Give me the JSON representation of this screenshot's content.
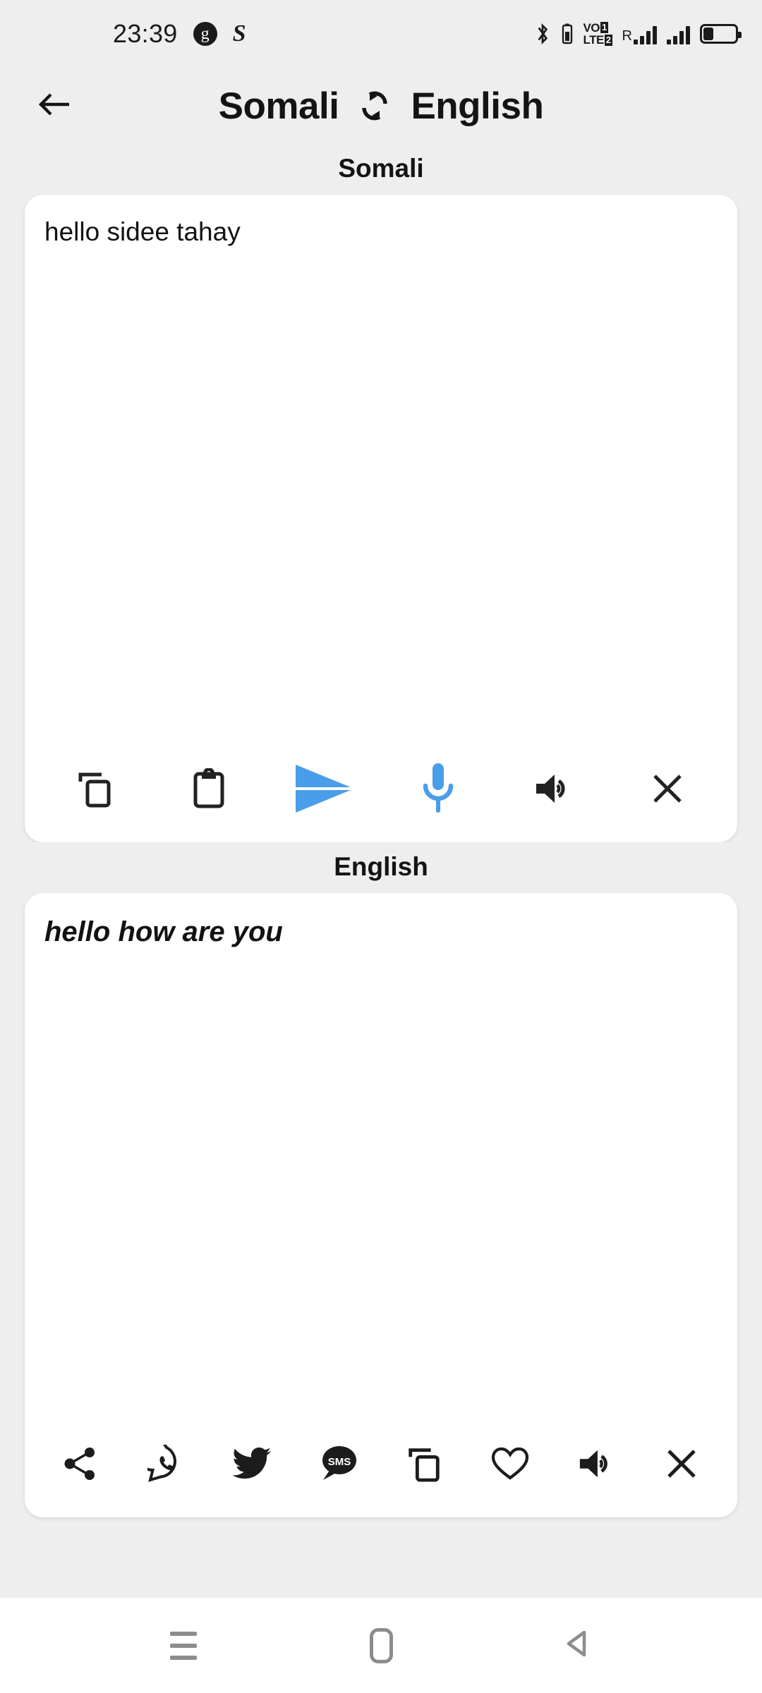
{
  "status_bar": {
    "clock": "23:39",
    "app_icon_g": "g",
    "app_icon_s": "S",
    "bluetooth_icon": "bluetooth-icon",
    "volte_line1": "VO",
    "volte_line2": "LTE",
    "sim1_label": "1",
    "sim2_label": "2",
    "roaming_label": "R",
    "battery_icon": "battery-low-icon"
  },
  "header": {
    "back_icon": "back-arrow-icon",
    "source_language": "Somali",
    "swap_icon": "swap-languages-icon",
    "target_language": "English"
  },
  "source_section": {
    "label": "Somali",
    "text": "hello sidee tahay",
    "toolbar": [
      {
        "name": "copy-icon",
        "label": "Copy",
        "accent": "#222222"
      },
      {
        "name": "paste-icon",
        "label": "Paste",
        "accent": "#222222"
      },
      {
        "name": "send-icon",
        "label": "Translate",
        "accent": "#4A9DE8"
      },
      {
        "name": "microphone-icon",
        "label": "Voice input",
        "accent": "#4A9DE8"
      },
      {
        "name": "speaker-icon",
        "label": "Speak",
        "accent": "#222222"
      },
      {
        "name": "clear-icon",
        "label": "Clear",
        "accent": "#222222"
      }
    ]
  },
  "target_section": {
    "label": "English",
    "text": "hello how are you",
    "toolbar": [
      {
        "name": "share-icon",
        "label": "Share"
      },
      {
        "name": "whatsapp-icon",
        "label": "WhatsApp"
      },
      {
        "name": "twitter-icon",
        "label": "Twitter"
      },
      {
        "name": "sms-icon",
        "label": "SMS"
      },
      {
        "name": "copy-icon",
        "label": "Copy"
      },
      {
        "name": "favorite-icon",
        "label": "Favorite"
      },
      {
        "name": "speaker-icon",
        "label": "Speak"
      },
      {
        "name": "clear-icon",
        "label": "Clear"
      }
    ]
  },
  "nav_bar": {
    "recents_label": "Recents",
    "home_label": "Home",
    "back_label": "Back"
  },
  "colors": {
    "background": "#EEEEEE",
    "card": "#FFFFFF",
    "text": "#141414",
    "accent_blue": "#4A9DE8",
    "nav_icon": "#8C8C8C"
  }
}
